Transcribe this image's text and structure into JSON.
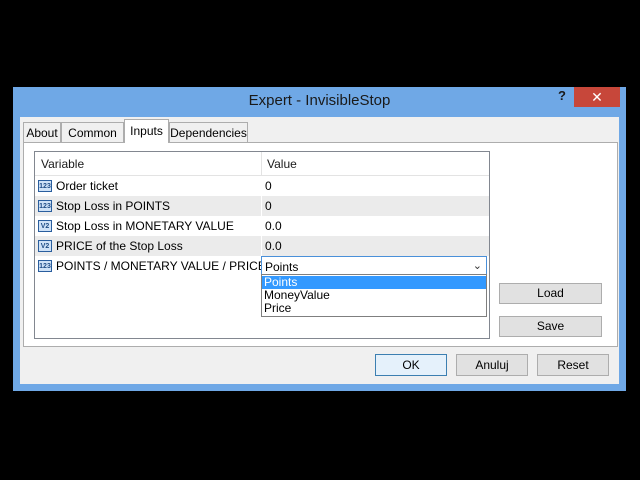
{
  "window": {
    "title": "Expert - InvisibleStop",
    "help_label": "?",
    "close_label": "✕"
  },
  "tabs": [
    {
      "label": "About",
      "active": false
    },
    {
      "label": "Common",
      "active": false
    },
    {
      "label": "Inputs",
      "active": true
    },
    {
      "label": "Dependencies",
      "active": false
    }
  ],
  "grid": {
    "headers": {
      "variable": "Variable",
      "value": "Value"
    },
    "rows": [
      {
        "icon": "int-icon",
        "icon_text": "123",
        "name": "Order ticket",
        "value": "0"
      },
      {
        "icon": "int-icon",
        "icon_text": "123",
        "name": "Stop Loss in POINTS",
        "value": "0"
      },
      {
        "icon": "double-icon",
        "icon_text": "V2",
        "name": "Stop Loss in MONETARY VALUE",
        "value": "0.0"
      },
      {
        "icon": "double-icon",
        "icon_text": "V2",
        "name": "PRICE of the Stop Loss",
        "value": "0.0"
      },
      {
        "icon": "int-icon",
        "icon_text": "123",
        "name": "POINTS / MONETARY VALUE / PRICE",
        "value": "Points"
      }
    ]
  },
  "dropdown": {
    "options": [
      "Points",
      "MoneyValue",
      "Price"
    ],
    "highlighted": "Points"
  },
  "side_buttons": {
    "load": "Load",
    "save": "Save"
  },
  "footer_buttons": {
    "ok": "OK",
    "cancel": "Anuluj",
    "reset": "Reset"
  },
  "colors": {
    "title_bar": "#6fa8e6",
    "close_button": "#c7473a",
    "selection": "#3399ff"
  }
}
